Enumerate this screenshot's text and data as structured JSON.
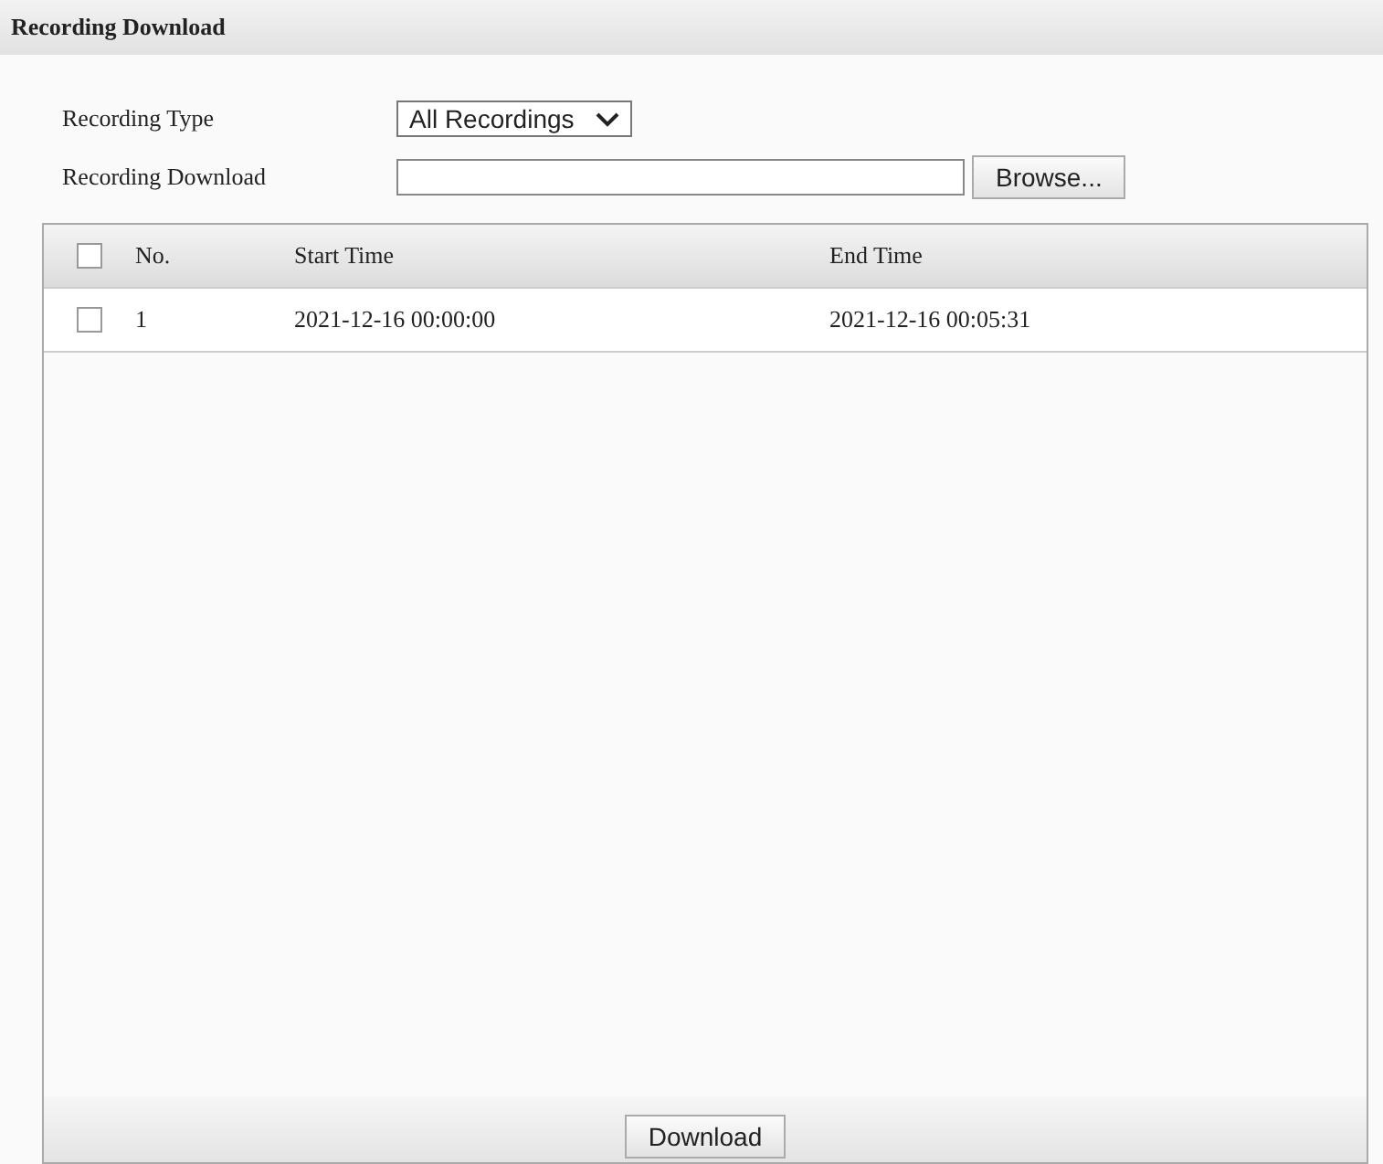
{
  "title": "Recording Download",
  "form": {
    "type_label": "Recording Type",
    "type_value": "All Recordings",
    "download_label": "Recording Download",
    "browse_button": "Browse..."
  },
  "table": {
    "header_checked": false,
    "columns": [
      "No.",
      "Start Time",
      "End Time"
    ],
    "rows": [
      {
        "checked": false,
        "cells": [
          "1",
          "2021-12-16 00:00:00",
          "2021-12-16 00:05:31"
        ]
      }
    ]
  },
  "download_button": "Download"
}
